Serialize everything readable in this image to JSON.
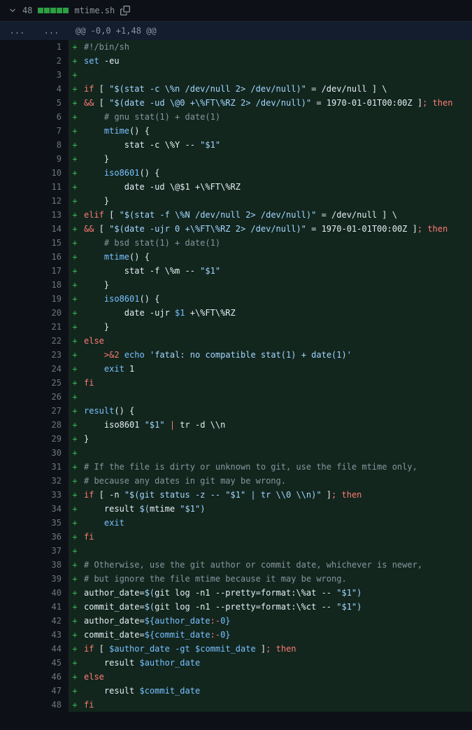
{
  "header": {
    "count": "48",
    "filename": "mtime.sh"
  },
  "hunk": "@@ -0,0 +1,48 @@",
  "lines": [
    {
      "n": "1",
      "html": "<span class='tok-cmt'>#!/bin/sh</span>"
    },
    {
      "n": "2",
      "html": "<span class='tok-builtin'>set</span> -eu"
    },
    {
      "n": "3",
      "html": ""
    },
    {
      "n": "4",
      "html": "<span class='tok-kw'>if</span> [ <span class='tok-str'>\"$(stat -c \\%n /dev/null 2&gt; /dev/null)\"</span> = /dev/null ] \\"
    },
    {
      "n": "5",
      "html": "<span class='tok-op'>&amp;&amp;</span> [ <span class='tok-str'>\"$(date -ud \\@0 +\\%FT\\%RZ 2&gt; /dev/null)\"</span> = 1970-01-01T00:00Z ]<span class='tok-kw'>;</span> <span class='tok-then'>then</span>"
    },
    {
      "n": "6",
      "html": "    <span class='tok-cmt'># gnu stat(1) + date(1)</span>"
    },
    {
      "n": "7",
      "html": "    <span class='tok-builtin'>mtime</span>() {"
    },
    {
      "n": "8",
      "html": "        stat -c \\%Y -- <span class='tok-str'>\"$1\"</span>"
    },
    {
      "n": "9",
      "html": "    }"
    },
    {
      "n": "10",
      "html": "    <span class='tok-builtin'>iso8601</span>() {"
    },
    {
      "n": "11",
      "html": "        date -ud \\@$1 +\\%FT\\%RZ"
    },
    {
      "n": "12",
      "html": "    }"
    },
    {
      "n": "13",
      "html": "<span class='tok-kw'>elif</span> [ <span class='tok-str'>\"$(stat -f \\%N /dev/null 2&gt; /dev/null)\"</span> = /dev/null ] \\"
    },
    {
      "n": "14",
      "html": "<span class='tok-op'>&amp;&amp;</span> [ <span class='tok-str'>\"$(date -ujr 0 +\\%FT\\%RZ 2&gt; /dev/null)\"</span> = 1970-01-01T00:00Z ]<span class='tok-kw'>;</span> <span class='tok-then'>then</span>"
    },
    {
      "n": "15",
      "html": "    <span class='tok-cmt'># bsd stat(1) + date(1)</span>"
    },
    {
      "n": "16",
      "html": "    <span class='tok-builtin'>mtime</span>() {"
    },
    {
      "n": "17",
      "html": "        stat -f \\%m -- <span class='tok-str'>\"$1\"</span>"
    },
    {
      "n": "18",
      "html": "    }"
    },
    {
      "n": "19",
      "html": "    <span class='tok-builtin'>iso8601</span>() {"
    },
    {
      "n": "20",
      "html": "        date -ujr <span class='tok-num'>$1</span> +\\%FT\\%RZ"
    },
    {
      "n": "21",
      "html": "    }"
    },
    {
      "n": "22",
      "html": "<span class='tok-kw'>else</span>"
    },
    {
      "n": "23",
      "html": "    <span class='tok-op'>&gt;&amp;2</span> <span class='tok-builtin'>echo</span> <span class='tok-str'>'fatal: no compatible stat(1) + date(1)'</span>"
    },
    {
      "n": "24",
      "html": "    <span class='tok-builtin'>exit</span> 1"
    },
    {
      "n": "25",
      "html": "<span class='tok-kw'>fi</span>"
    },
    {
      "n": "26",
      "html": ""
    },
    {
      "n": "27",
      "html": "<span class='tok-builtin'>result</span>() {"
    },
    {
      "n": "28",
      "html": "    iso8601 <span class='tok-str'>\"$1\"</span> <span class='tok-op'>|</span> tr -d \\\\n"
    },
    {
      "n": "29",
      "html": "}"
    },
    {
      "n": "30",
      "html": ""
    },
    {
      "n": "31",
      "html": "<span class='tok-cmt'># If the file is dirty or unknown to git, use the file mtime only,</span>"
    },
    {
      "n": "32",
      "html": "<span class='tok-cmt'># because any dates in git may be wrong.</span>"
    },
    {
      "n": "33",
      "html": "<span class='tok-kw'>if</span> [ -n <span class='tok-str'>\"$(git status -z -- \"$1\" | tr \\\\0 \\\\n)\"</span> ]<span class='tok-kw'>;</span> <span class='tok-then'>then</span>"
    },
    {
      "n": "34",
      "html": "    result <span class='tok-str'>$(</span>mtime <span class='tok-str'>\"$1\")</span>"
    },
    {
      "n": "35",
      "html": "    <span class='tok-builtin'>exit</span>"
    },
    {
      "n": "36",
      "html": "<span class='tok-kw'>fi</span>"
    },
    {
      "n": "37",
      "html": ""
    },
    {
      "n": "38",
      "html": "<span class='tok-cmt'># Otherwise, use the git author or commit date, whichever is newer,</span>"
    },
    {
      "n": "39",
      "html": "<span class='tok-cmt'># but ignore the file mtime because it may be wrong.</span>"
    },
    {
      "n": "40",
      "html": "author_date=<span class='tok-str'>$(</span>git log -n1 --pretty=format:\\%at -- <span class='tok-str'>\"$1\")</span>"
    },
    {
      "n": "41",
      "html": "commit_date=<span class='tok-str'>$(</span>git log -n1 --pretty=format:\\%ct -- <span class='tok-str'>\"$1\")</span>"
    },
    {
      "n": "42",
      "html": "author_date=<span class='tok-num'>${author_date</span><span class='tok-kw'>:-</span><span class='tok-num'>0}</span>"
    },
    {
      "n": "43",
      "html": "commit_date=<span class='tok-num'>${commit_date</span><span class='tok-kw'>:-</span><span class='tok-num'>0}</span>"
    },
    {
      "n": "44",
      "html": "<span class='tok-kw'>if</span> [ <span class='tok-num'>$author_date</span> <span class='tok-builtin'>-gt</span> <span class='tok-num'>$commit_date</span> ]<span class='tok-kw'>;</span> <span class='tok-then'>then</span>"
    },
    {
      "n": "45",
      "html": "    result <span class='tok-num'>$author_date</span>"
    },
    {
      "n": "46",
      "html": "<span class='tok-kw'>else</span>"
    },
    {
      "n": "47",
      "html": "    result <span class='tok-num'>$commit_date</span>"
    },
    {
      "n": "48",
      "html": "<span class='tok-kw'>fi</span>"
    }
  ]
}
